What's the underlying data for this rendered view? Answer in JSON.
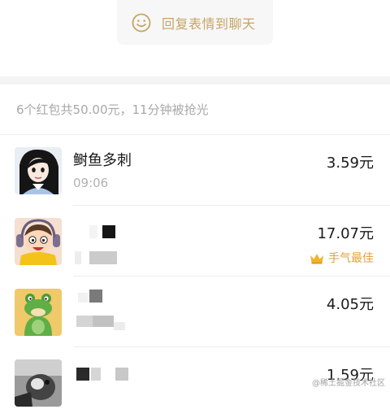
{
  "reply_button": {
    "label": "回复表情到聊天",
    "icon": "smiley-icon"
  },
  "summary": "6个红包共50.00元，11分钟被抢光",
  "records": [
    {
      "name": "鲥鱼多刺",
      "time": "09:06",
      "amount": "3.59元",
      "best": ""
    },
    {
      "name": "",
      "time": "",
      "amount": "17.07元",
      "best": "手气最佳"
    },
    {
      "name": "",
      "time": "",
      "amount": "4.05元",
      "best": ""
    },
    {
      "name": "",
      "time": "",
      "amount": "1.59元",
      "best": ""
    }
  ],
  "best_icon": "crown-icon",
  "watermark": "@稀土掘金技术社区",
  "colors": {
    "accent_gold": "#c7a466",
    "best_gold": "#e0a23c",
    "muted_text": "#a8a8a8"
  }
}
